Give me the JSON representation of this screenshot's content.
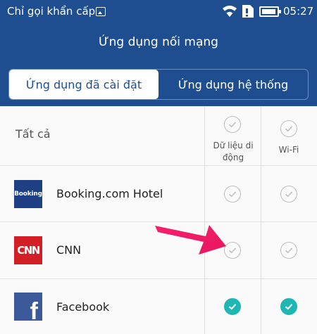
{
  "status_bar": {
    "carrier": "Chỉ gọi khẩn cấp",
    "time": "05:27"
  },
  "header": {
    "title": "Ứng dụng nối mạng"
  },
  "tabs": [
    {
      "label": "Ứng dụng đã cài đặt",
      "selected": true
    },
    {
      "label": "Ứng dụng hệ thống",
      "selected": false
    }
  ],
  "columns": {
    "all_label": "Tất cả",
    "mobile_data_line1": "Dữ liệu di",
    "mobile_data_line2": "động",
    "wifi": "Wi-Fi"
  },
  "apps": [
    {
      "name": "Booking.com Hotel",
      "icon": "Booking",
      "mobile_data": false,
      "wifi": false
    },
    {
      "name": "CNN",
      "icon": "CNN",
      "mobile_data": false,
      "wifi": false
    },
    {
      "name": "Facebook",
      "icon": "f",
      "mobile_data": true,
      "wifi": true
    }
  ],
  "colors": {
    "header_bg": "#1e4e8f",
    "check_on": "#1eb7b4",
    "arrow": "#f5216e"
  }
}
